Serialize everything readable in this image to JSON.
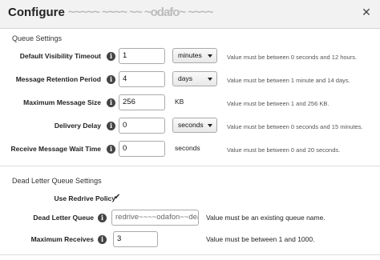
{
  "dialog": {
    "title": "Configure",
    "title_obscured": "~~~~~ ~~~~ ~~ ~odafo~ ~~~~",
    "close_label": "✕"
  },
  "queue_settings": {
    "heading": "Queue Settings",
    "rows": [
      {
        "label": "Default Visibility Timeout",
        "value": "1",
        "unit": "minutes",
        "hint": "Value must be between 0 seconds and 12 hours."
      },
      {
        "label": "Message Retention Period",
        "value": "4",
        "unit": "days",
        "hint": "Value must be between 1 minute and 14 days."
      },
      {
        "label": "Maximum Message Size",
        "value": "256",
        "unit": "KB",
        "hint": "Value must be between 1 and 256 KB."
      },
      {
        "label": "Delivery Delay",
        "value": "0",
        "unit": "seconds",
        "hint": "Value must be between 0 seconds and 15 minutes."
      },
      {
        "label": "Receive Message Wait Time",
        "value": "0",
        "unit": "seconds",
        "hint": "Value must be between 0 and 20 seconds."
      }
    ]
  },
  "dead_letter": {
    "heading": "Dead Letter Queue Settings",
    "redrive_label": "Use Redrive Policy",
    "redrive_checked": true,
    "queue_label": "Dead Letter Queue",
    "queue_value": "redrive~~~~odafon~~dead-l",
    "queue_hint": "Value must be an existing queue name.",
    "receives_label": "Maximum Receives",
    "receives_value": "3",
    "receives_hint": "Value must be between 1 and 1000."
  },
  "info_icon_glyph": "i",
  "checkbox_glyph": "✔"
}
